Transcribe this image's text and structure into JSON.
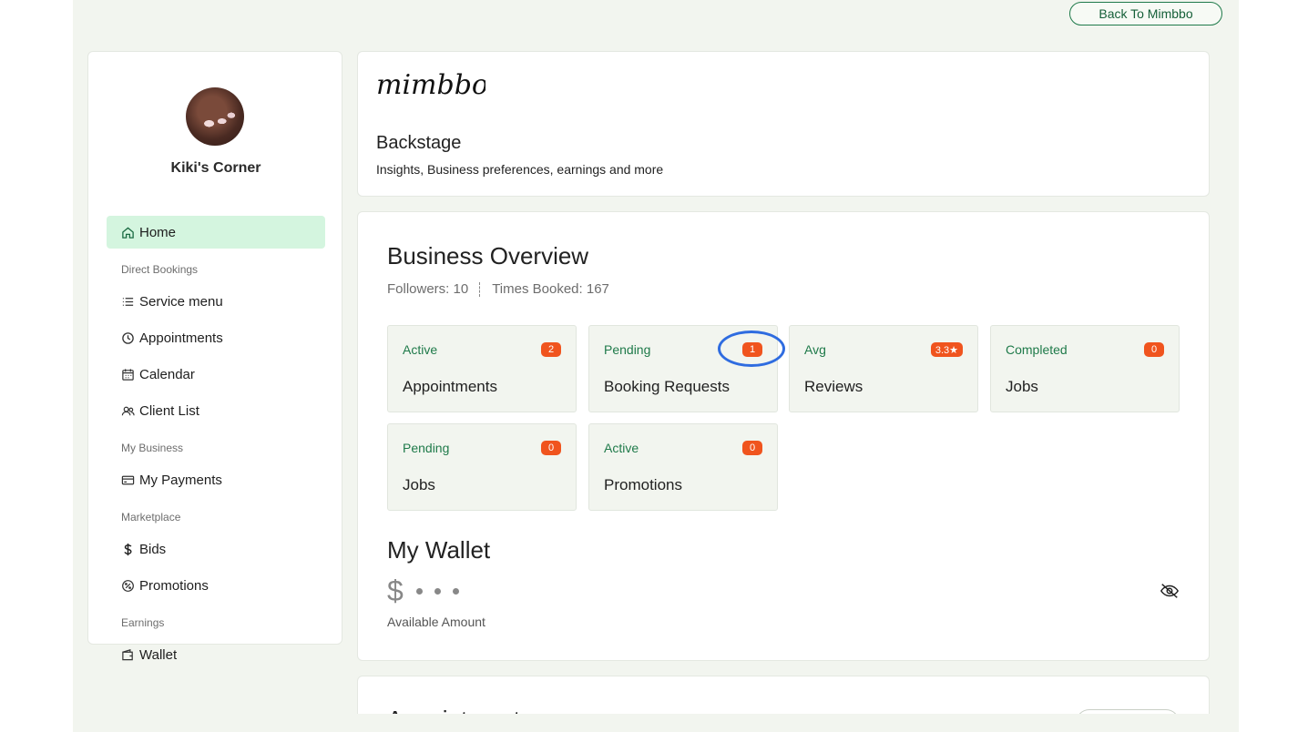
{
  "top": {
    "back_label": "Back To Mimbbo"
  },
  "sidebar": {
    "shop_name": "Kiki's Corner",
    "items": [
      {
        "label": "Home",
        "icon": "home-icon",
        "active": true
      },
      {
        "section": "Direct Bookings"
      },
      {
        "label": "Service menu",
        "icon": "list-icon"
      },
      {
        "label": "Appointments",
        "icon": "clock-icon"
      },
      {
        "label": "Calendar",
        "icon": "calendar-icon"
      },
      {
        "label": "Client List",
        "icon": "users-icon"
      },
      {
        "section": "My Business"
      },
      {
        "label": "My Payments",
        "icon": "credit-card-icon"
      },
      {
        "section": "Marketplace"
      },
      {
        "label": "Bids",
        "icon": "dollar-icon"
      },
      {
        "label": "Promotions",
        "icon": "badge-percent-icon"
      },
      {
        "section": "Earnings"
      },
      {
        "label": "Wallet",
        "icon": "wallet-icon"
      }
    ]
  },
  "header": {
    "logo_text": "mimbbo",
    "title": "Backstage",
    "subtitle": "Insights, Business preferences, earnings and more"
  },
  "overview": {
    "title": "Business Overview",
    "followers": "Followers: 10",
    "times_booked": "Times Booked: 167",
    "tiles": [
      {
        "status": "Active",
        "label": "Appointments",
        "badge": "2"
      },
      {
        "status": "Pending",
        "label": "Booking Requests",
        "badge": "1"
      },
      {
        "status": "Avg",
        "label": "Reviews",
        "badge": "3.3★"
      },
      {
        "status": "Completed",
        "label": "Jobs",
        "badge": "0"
      },
      {
        "status": "Pending",
        "label": "Jobs",
        "badge": "0"
      },
      {
        "status": "Active",
        "label": "Promotions",
        "badge": "0"
      }
    ]
  },
  "wallet": {
    "title": "My Wallet",
    "currency": "$",
    "sub": "Available Amount"
  },
  "next_section": {
    "title": "Appointments"
  },
  "colors": {
    "page_bg": "#f2f5ef",
    "accent_green": "#1f7a4a",
    "active_nav": "#d4f5df",
    "badge": "#f0541e",
    "highlight": "#2f6ce0"
  }
}
